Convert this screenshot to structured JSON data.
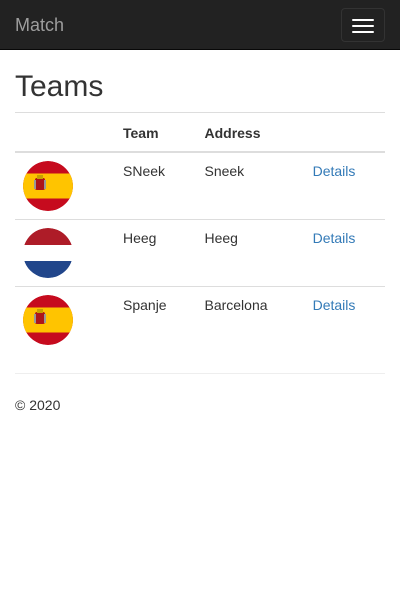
{
  "navbar": {
    "brand": "Match",
    "toggle_icon": "hamburger-menu-icon"
  },
  "page": {
    "title": "Teams"
  },
  "table": {
    "columns": [
      "",
      "Team",
      "Address",
      ""
    ],
    "rows": [
      {
        "flag": "spain-flag-icon",
        "team": "SNeek",
        "address": "Sneek",
        "action": "Details"
      },
      {
        "flag": "netherlands-flag-icon",
        "team": "Heeg",
        "address": "Heeg",
        "action": "Details"
      },
      {
        "flag": "spain-flag-icon",
        "team": "Spanje",
        "address": "Barcelona",
        "action": "Details"
      }
    ]
  },
  "footer": {
    "copyright": "© 2020"
  },
  "colors": {
    "navbar": "#222222",
    "link": "#337ab7",
    "spain_red": "#c60b1e",
    "spain_yellow": "#ffc400",
    "nl_red": "#ae1c28",
    "nl_blue": "#21468b"
  }
}
